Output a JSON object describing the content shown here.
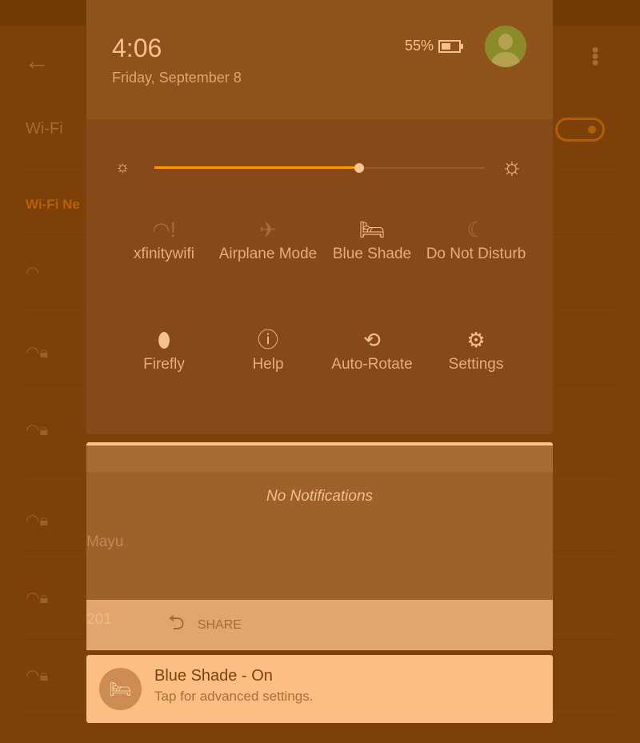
{
  "background": {
    "wifi_label": "Wi-Fi",
    "networks_header": "Wi-Fi Ne",
    "network_name_partial": "Mayu",
    "network_partial_2": "201"
  },
  "header": {
    "time": "4:06",
    "date": "Friday, September 8",
    "battery": "55%"
  },
  "brightness": {
    "level_percent": 62
  },
  "tiles": [
    {
      "label": "xfinitywifi",
      "icon": "wifi-alert-icon"
    },
    {
      "label": "Airplane Mode",
      "icon": "airplane-off-icon"
    },
    {
      "label": "Blue Shade",
      "icon": "bed-icon"
    },
    {
      "label": "Do Not Disturb",
      "icon": "moon-icon"
    },
    {
      "label": "Firefly",
      "icon": "firefly-icon"
    },
    {
      "label": "Help",
      "icon": "help-icon"
    },
    {
      "label": "Auto-Rotate",
      "icon": "rotate-icon"
    },
    {
      "label": "Settings",
      "icon": "gear-icon"
    }
  ],
  "notifications": {
    "empty_text": "No Notifications",
    "share_label": "SHARE"
  },
  "toast": {
    "title": "Blue Shade - On",
    "subtitle": "Tap for advanced settings."
  },
  "colors": {
    "accent": "#ff9a00",
    "toast_bg": "#fcbe82",
    "panel": "#87491a"
  }
}
